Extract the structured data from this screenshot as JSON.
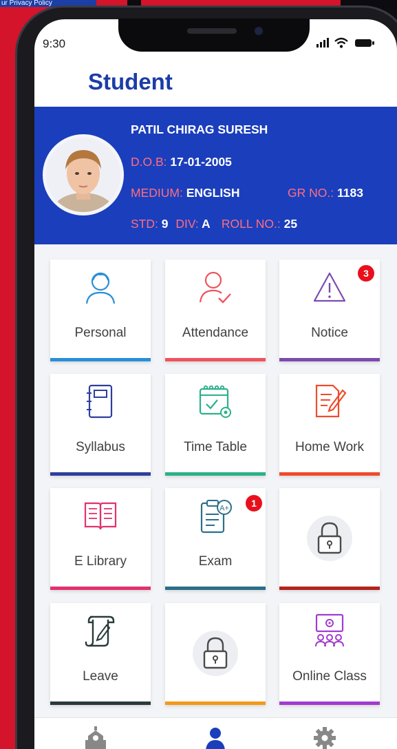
{
  "background": {
    "top_strip_text": "ur Privacy Policy"
  },
  "status_bar": {
    "time": "9:30"
  },
  "header": {
    "title": "Student"
  },
  "profile": {
    "name": "PATIL CHIRAG SURESH",
    "dob_label": "D.O.B:",
    "dob_value": "17-01-2005",
    "medium_label": "MEDIUM:",
    "medium_value": "ENGLISH",
    "gr_label": "GR NO.:",
    "gr_value": "1183",
    "std_label": "STD:",
    "std_value": "9",
    "div_label": "DIV:",
    "div_value": "A",
    "roll_label": "ROLL NO.:",
    "roll_value": "25"
  },
  "tiles": [
    {
      "label": "Personal",
      "icon": "user-icon",
      "bar_color": "#2a8fd6"
    },
    {
      "label": "Attendance",
      "icon": "user-check-icon",
      "bar_color": "#f0545d"
    },
    {
      "label": "Notice",
      "icon": "warning-icon",
      "bar_color": "#7b4bb0",
      "badge": "3"
    },
    {
      "label": "Syllabus",
      "icon": "notebook-icon",
      "bar_color": "#2d3f9c"
    },
    {
      "label": "Time Table",
      "icon": "calendar-icon",
      "bar_color": "#2bb08a"
    },
    {
      "label": "Home Work",
      "icon": "document-pen-icon",
      "bar_color": "#ee4b2b"
    },
    {
      "label": "E Library",
      "icon": "open-book-icon",
      "bar_color": "#e0336e"
    },
    {
      "label": "Exam",
      "icon": "exam-clipboard-icon",
      "bar_color": "#2a6f8a",
      "badge": "1"
    },
    {
      "label": "",
      "icon": "lock-icon",
      "bar_color": "#b3241f"
    },
    {
      "label": "Leave",
      "icon": "scroll-pen-icon",
      "bar_color": "#2a3a3a"
    },
    {
      "label": "",
      "icon": "lock-icon",
      "bar_color": "#f39a1a"
    },
    {
      "label": "Online Class",
      "icon": "online-class-icon",
      "bar_color": "#a23bd0"
    }
  ],
  "bottom_nav": [
    {
      "icon": "school-icon"
    },
    {
      "icon": "person-icon",
      "active": true
    },
    {
      "icon": "gear-icon"
    }
  ]
}
